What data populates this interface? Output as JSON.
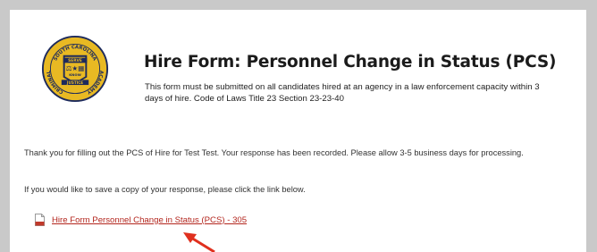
{
  "header": {
    "title": "Hire Form: Personnel Change in Status (PCS)",
    "subtitle": "This form must be submitted on all candidates hired at an agency in a law enforcement capacity within 3 days of hire. Code of Laws Title 23 Section 23-23-40"
  },
  "logo": {
    "ring_top": "SOUTH CAROLINA",
    "ring_left": "CRIMINAL",
    "ring_right": "ACADEMY",
    "banner_top": "SERVE",
    "banner_mid": "KNOW",
    "banner_bottom": "JUSTICE",
    "colors": {
      "gold": "#e8b923",
      "navy": "#1d2a5c"
    }
  },
  "confirmation": {
    "message": "Thank you for filling out the PCS of Hire for  Test Test. Your response has been recorded. Please allow 3-5 business days for processing.",
    "save_note": "If you would like to save a copy of your response, please click the link below.",
    "file_link": "Hire Form Personnel Change in Status (PCS) - 305",
    "file_icon": "pdf-file-icon"
  },
  "colors": {
    "link": "#b3261e",
    "annotation_arrow": "#e0301e",
    "page_background": "#c9c9c9"
  }
}
